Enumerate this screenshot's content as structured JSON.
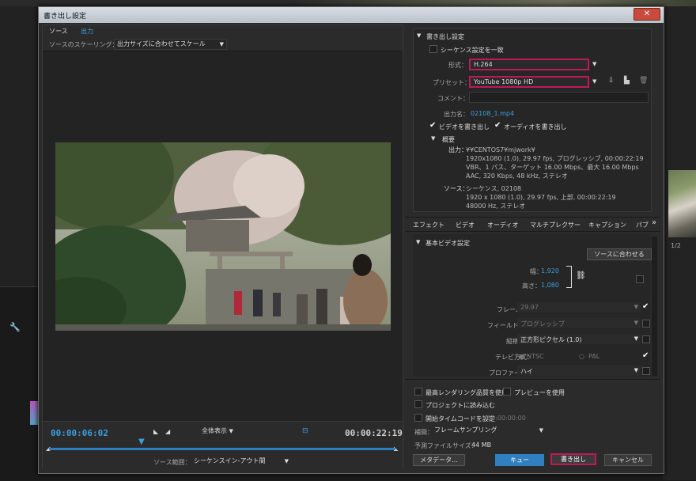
{
  "dialog": {
    "title": "書き出し設定",
    "close_label": "✕"
  },
  "left": {
    "tabs": [
      "ソース",
      "出力"
    ],
    "scaling_label": "ソースのスケーリング：",
    "scaling_value": "出力サイズに合わせてスケール",
    "timecode_current": "00:00:06:02",
    "timecode_end": "00:00:22:19",
    "fit_value": "全体表示",
    "range_label": "ソース範囲：",
    "range_value": "シーケンスイン-アウト間"
  },
  "export": {
    "section_title": "書き出し設定",
    "match_sequence_label": "シーケンス設定を一致",
    "format_label": "形式：",
    "format_value": "H.264",
    "preset_label": "プリセット：",
    "preset_value": "YouTube 1080p HD",
    "comment_label": "コメント：",
    "output_name_label": "出力名：",
    "output_name_value": "02108_1.mp4",
    "export_video_label": "ビデオを書き出し",
    "export_audio_label": "オーディオを書き出し",
    "summary_title": "概要",
    "output_label": "出力：",
    "output_lines": [
      "¥¥CENTOS7¥mjwork¥",
      "1920x1080 (1.0), 29.97 fps, プログレッシブ, 00:00:22:19",
      "VBR、1 パス、ターゲット 16.00 Mbps、最大 16.00 Mbps",
      "AAC, 320 Kbps, 48 kHz, ステレオ"
    ],
    "source_label": "ソース：",
    "source_lines": [
      "シーケンス, 02108",
      "1920 x 1080 (1.0), 29.97 fps, 上部, 00:00:22:19",
      "48000 Hz, ステレオ"
    ]
  },
  "tabs2": [
    "エフェクト",
    "ビデオ",
    "オーディオ",
    "マルチプレクサー",
    "キャプション",
    "パブ"
  ],
  "video": {
    "section_title": "基本ビデオ設定",
    "match_source_label": "ソースに合わせる",
    "width_label": "幅：",
    "width_value": "1,920",
    "height_label": "高さ：",
    "height_value": "1,080",
    "framerate_label": "フレームレート：",
    "framerate_value": "29.97",
    "field_order_label": "フィールドオーダー：",
    "field_order_value": "プログレッシブ",
    "aspect_label": "縦横比：",
    "aspect_value": "正方形ピクセル (1.0)",
    "tv_label": "テレビ方式：",
    "tv_ntsc": "NTSC",
    "tv_pal": "PAL",
    "profile_label": "プロファイル：",
    "profile_value": "ハイ"
  },
  "bottom": {
    "max_render_label": "最高レンダリング品質を使用",
    "preview_label": "プレビューを使用",
    "import_label": "プロジェクトに読み込む",
    "start_tc_label": "開始タイムコードを設定",
    "start_tc_value": "00:00:00:00",
    "interp_label": "補間：",
    "interp_value": "フレームサンプリング",
    "filesize_label": "予測ファイルサイズ：",
    "filesize_value": "44 MB",
    "metadata_btn": "メタデータ...",
    "queue_btn": "キュー",
    "export_btn": "書き出し",
    "cancel_btn": "キャンセル"
  },
  "bg": {
    "right_label": "1/2"
  }
}
